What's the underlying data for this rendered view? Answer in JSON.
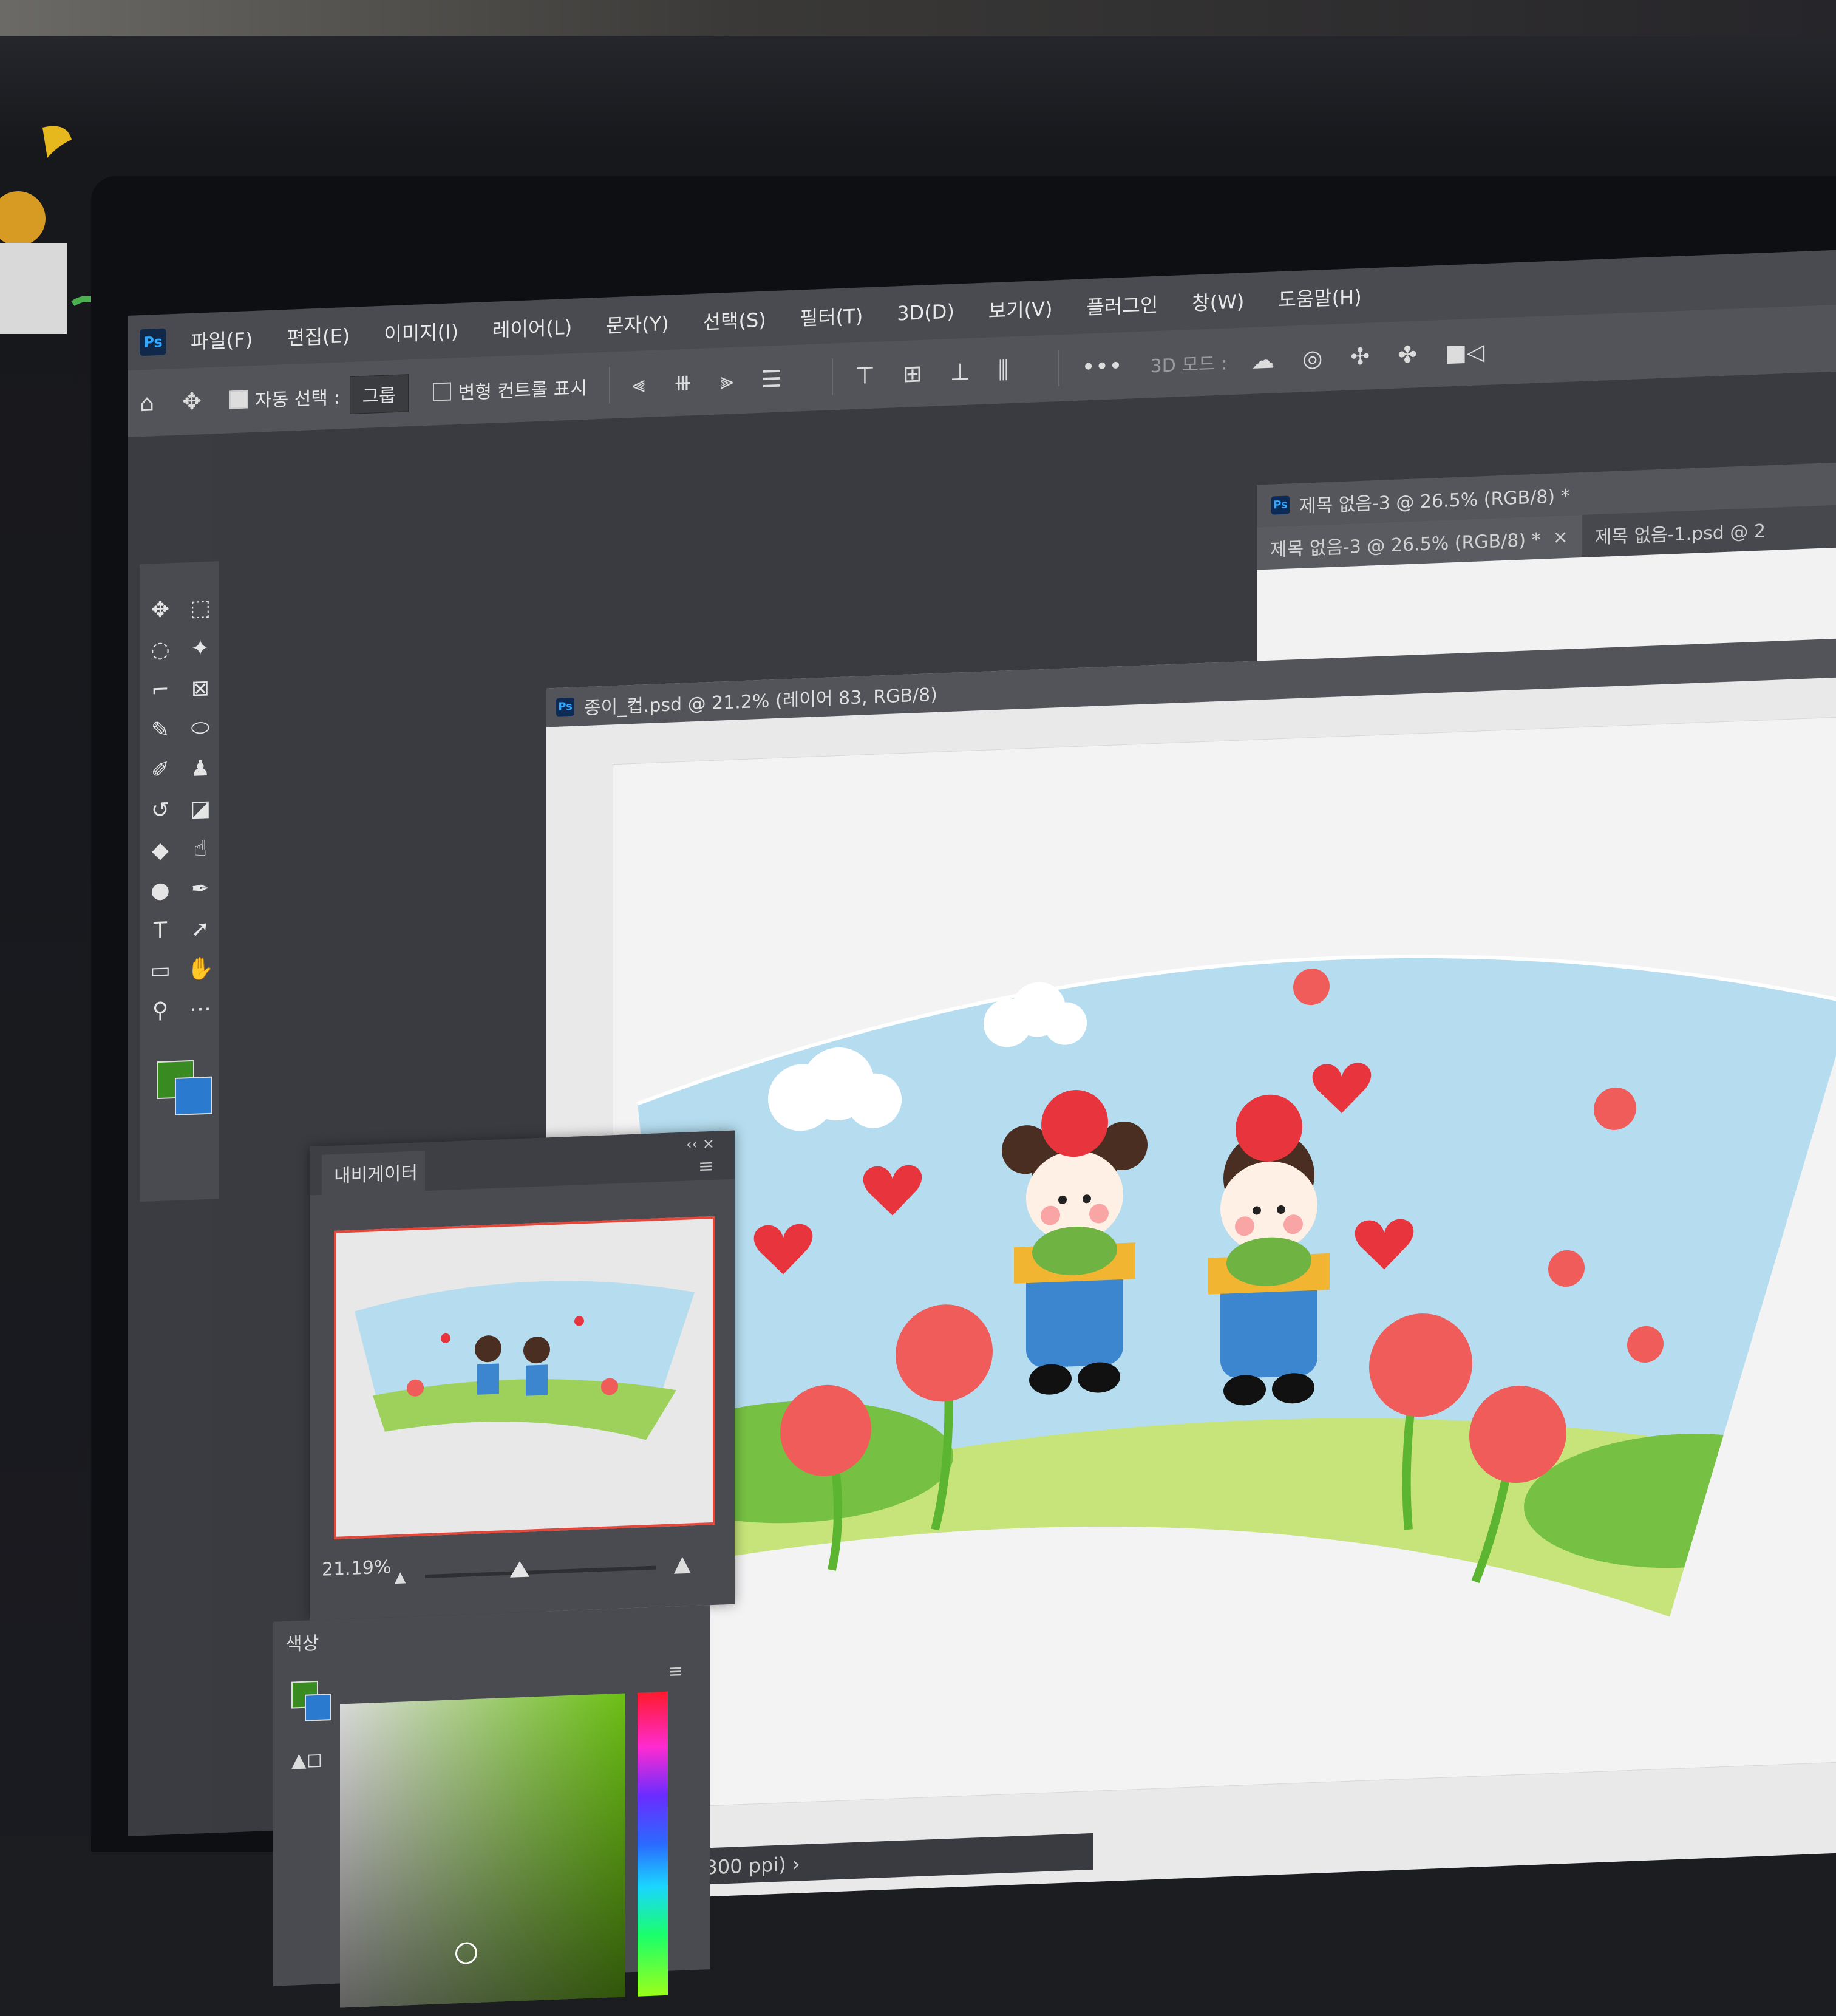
{
  "menubar": {
    "app_icon": "Ps",
    "items": [
      "파일(F)",
      "편집(E)",
      "이미지(I)",
      "레이어(L)",
      "문자(Y)",
      "선택(S)",
      "필터(T)",
      "3D(D)",
      "보기(V)",
      "플러그인",
      "창(W)",
      "도움말(H)"
    ]
  },
  "options": {
    "auto_select_label": "자동 선택 :",
    "auto_select_value": "그룹",
    "transform_controls_label": "변형 컨트롤 표시",
    "more_label": "•••",
    "mode_3d_label": "3D 모드 :"
  },
  "documents": {
    "secondary_title": "제목 없음-3 @ 26.5% (RGB/8) *",
    "tabs": [
      {
        "label": "제목 없음-3 @ 26.5% (RGB/8) *",
        "close": "×"
      },
      {
        "label": "제목 없음-1.psd @ 2"
      }
    ],
    "main_title": "종이_컵.psd @ 21.2% (레이어 83, RGB/8)",
    "main_controls": "▬  ▭"
  },
  "navigator": {
    "tab_label": "내비게이터",
    "zoom": "21.19%",
    "menu_icon": "≡",
    "collapse": "‹‹  ×"
  },
  "color_panel": {
    "tab_label": "색상",
    "menu_icon": "≡",
    "warning": "▲◻"
  },
  "status": {
    "text": "픽셀 (300 ppi)   ›"
  },
  "colors": {
    "foreground": "#3a8a22",
    "background": "#2a7bd0",
    "accent": "#31a8ff"
  },
  "icons": [
    "home-icon",
    "move-icon",
    "marquee-icon",
    "lasso-icon",
    "magic-wand-icon",
    "crop-icon",
    "frame-icon",
    "eyedropper-icon",
    "healing-icon",
    "brush-icon",
    "stamp-icon",
    "history-brush-icon",
    "eraser-icon",
    "bucket-icon",
    "smudge-icon",
    "dodge-icon",
    "pen-icon",
    "type-icon",
    "path-select-icon",
    "rectangle-icon",
    "hand-icon",
    "zoom-icon",
    "more-icon"
  ]
}
